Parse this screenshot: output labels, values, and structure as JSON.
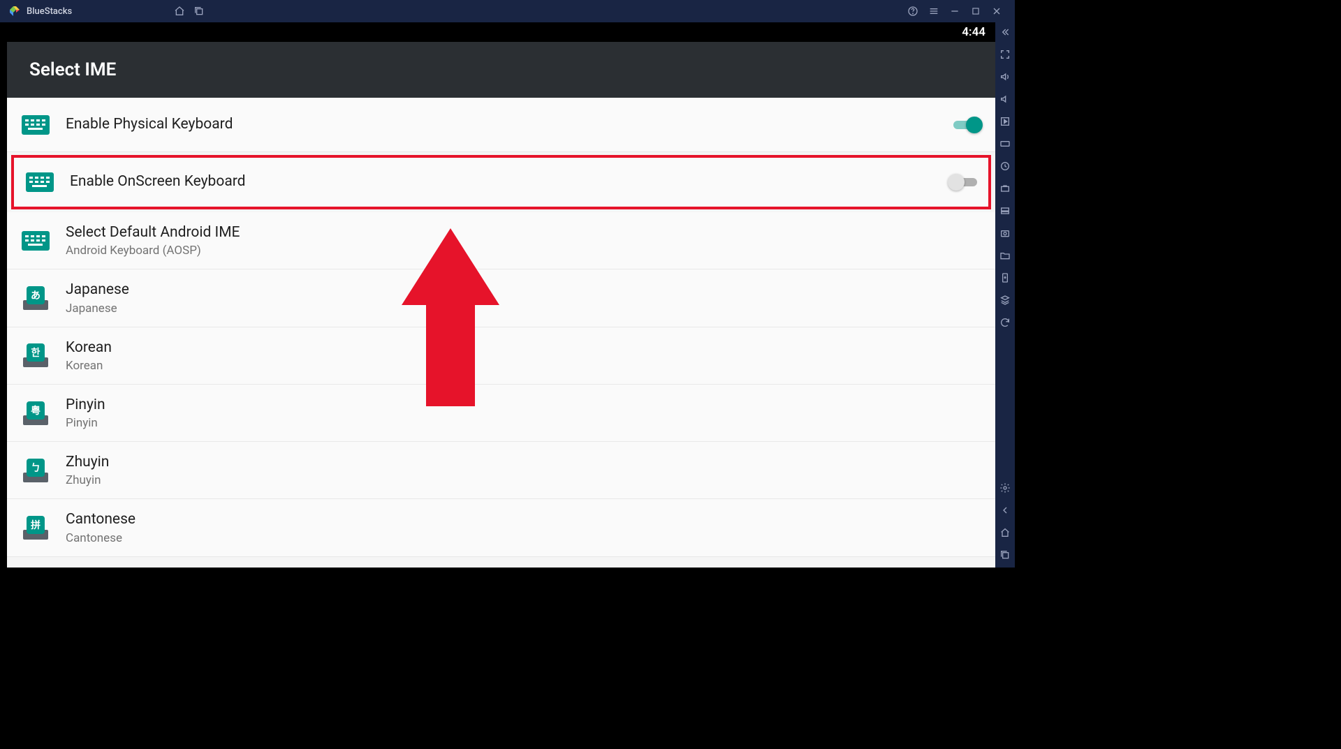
{
  "app": {
    "name": "BlueStacks"
  },
  "statusbar": {
    "time": "4:44"
  },
  "page": {
    "title": "Select IME"
  },
  "settings": {
    "physical": {
      "title": "Enable Physical Keyboard",
      "on": true
    },
    "onscreen": {
      "title": "Enable OnScreen Keyboard",
      "on": false
    },
    "default_ime": {
      "title": "Select Default Android IME",
      "sub": "Android Keyboard (AOSP)"
    },
    "langs": [
      {
        "title": "Japanese",
        "sub": "Japanese",
        "glyph": "あ"
      },
      {
        "title": "Korean",
        "sub": "Korean",
        "glyph": "한"
      },
      {
        "title": "Pinyin",
        "sub": "Pinyin",
        "glyph": "粤"
      },
      {
        "title": "Zhuyin",
        "sub": "Zhuyin",
        "glyph": "ㄅ"
      },
      {
        "title": "Cantonese",
        "sub": "Cantonese",
        "glyph": "拼"
      }
    ]
  },
  "colors": {
    "accent": "#009688",
    "highlight_border": "#e6132a",
    "titlebar": "#192544"
  }
}
